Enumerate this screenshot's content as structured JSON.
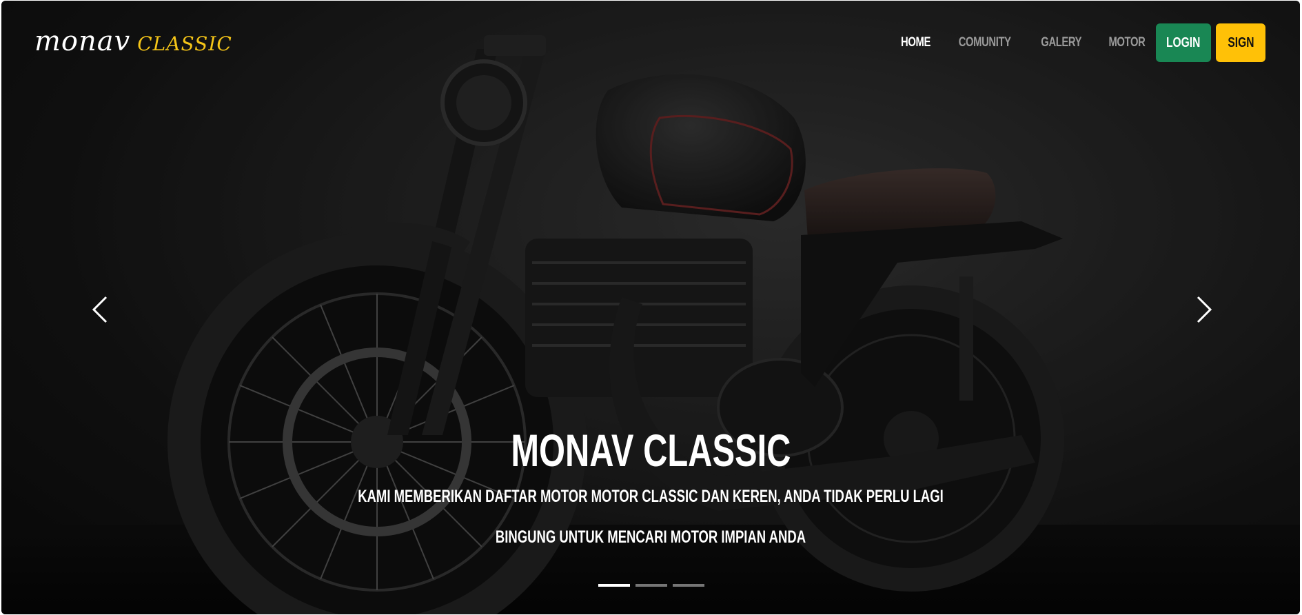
{
  "brand": {
    "logo_part1": "monav",
    "logo_part2": "classic",
    "accent_color": "#f5c518"
  },
  "nav": {
    "links": [
      {
        "label": "HOME",
        "active": true
      },
      {
        "label": "COMUNITY",
        "active": false
      },
      {
        "label": "GALERY",
        "active": false
      },
      {
        "label": "MOTOR",
        "active": false
      }
    ],
    "login_label": "LOGIN",
    "login_color": "#198754",
    "sign_label": "SIGN",
    "sign_color": "#ffc107"
  },
  "carousel": {
    "prev_icon": "chevron-left-icon",
    "next_icon": "chevron-right-icon",
    "slide_count": 3,
    "active_slide": 1,
    "caption": {
      "title": "MONAV CLASSIC",
      "line1": "KAMI MEMBERIKAN DAFTAR MOTOR MOTOR CLASSIC DAN KEREN, ANDA TIDAK PERLU LAGI",
      "line2": "BINGUNG UNTUK MENCARI MOTOR IMPIAN ANDA"
    }
  }
}
